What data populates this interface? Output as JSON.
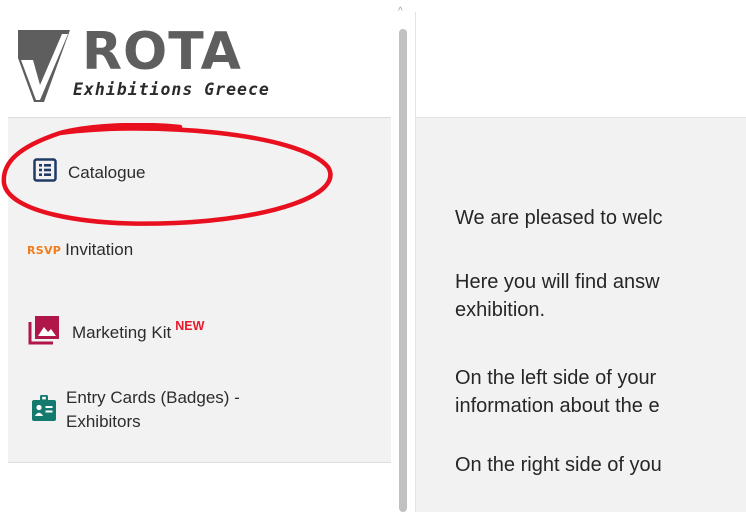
{
  "logo": {
    "word": "ROTA",
    "subtitle": "Exhibitions Greece"
  },
  "sidebar": {
    "items": [
      {
        "label": "Catalogue",
        "icon": "list-icon"
      },
      {
        "prefix": "RSVP",
        "label": "Invitation",
        "icon": "rsvp-icon"
      },
      {
        "label": "Marketing Kit",
        "badge": "NEW",
        "icon": "gallery-icon"
      },
      {
        "label_line1": "Entry Cards (Badges) -",
        "label_line2": "Exhibitors",
        "icon": "badge-icon"
      }
    ]
  },
  "main": {
    "paragraphs": [
      {
        "lines": [
          "We are pleased to welc"
        ]
      },
      {
        "lines": [
          "Here you will find answ",
          "exhibition."
        ]
      },
      {
        "lines": [
          "On the left side of your",
          "information about the e"
        ]
      },
      {
        "lines": [
          "On the right side of you"
        ]
      }
    ]
  },
  "colors": {
    "sidebar_bg": "#f2f2f2",
    "catalogue_icon": "#1f3a64",
    "rsvp_orange": "#f07d1b",
    "new_red": "#e8192c",
    "gallery_icon": "#b0164a",
    "badge_icon": "#157a6e",
    "annotation_red": "#e8101e",
    "logo_gray": "#5e5e5e"
  }
}
